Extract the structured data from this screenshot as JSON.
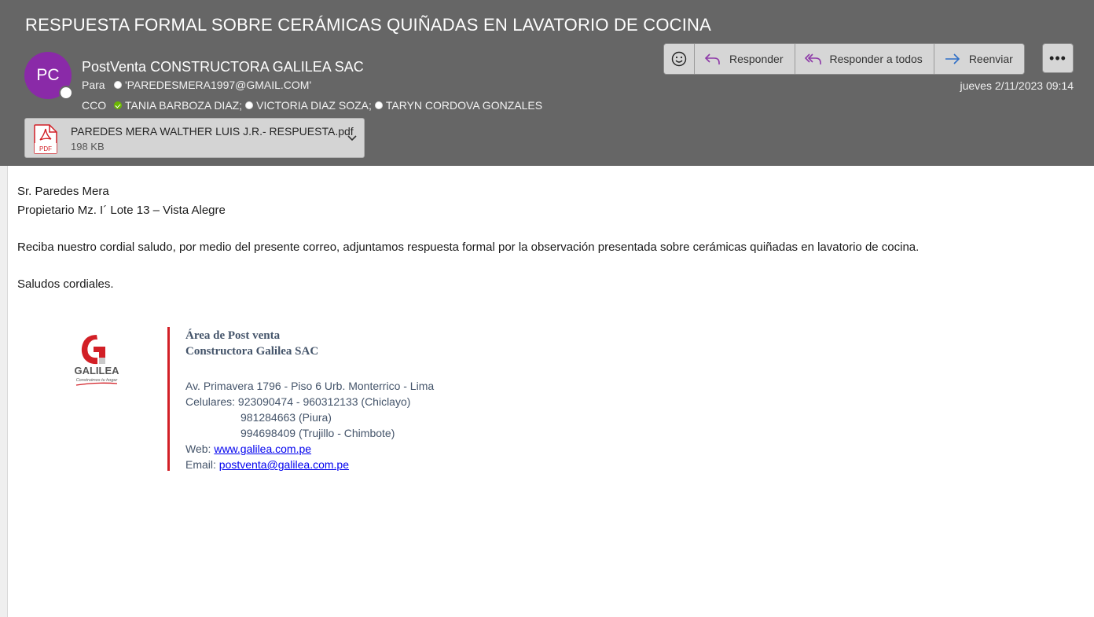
{
  "email": {
    "subject": "RESPUESTA FORMAL SOBRE CERÁMICAS QUIÑADAS EN LAVATORIO DE COCINA",
    "avatar_initials": "PC",
    "sender": "PostVenta CONSTRUCTORA GALILEA SAC",
    "to_label": "Para",
    "to": [
      "'PAREDESMERA1997@GMAIL.COM'"
    ],
    "cc_label": "CCO",
    "cc": [
      "TANIA BARBOZA DIAZ;",
      "VICTORIA DIAZ SOZA;",
      "TARYN CORDOVA GONZALES"
    ],
    "date": "jueves 2/11/2023 09:14"
  },
  "toolbar": {
    "emoji_icon": "smiley-icon",
    "reply_label": "Responder",
    "reply_all_label": "Responder a todos",
    "forward_label": "Reenviar",
    "more_label": "•••"
  },
  "attachment": {
    "name": "PAREDES MERA WALTHER LUIS J.R.- RESPUESTA.pdf",
    "size": "198 KB",
    "icon_text": "PDF"
  },
  "body": {
    "line1": "Sr. Paredes Mera",
    "line2": "Propietario Mz. I´ Lote 13 – Vista Alegre",
    "line3": "Reciba nuestro cordial saludo, por medio del presente correo, adjuntamos respuesta formal por la observación presentada sobre cerámicas quiñadas en lavatorio de cocina.",
    "line4": "Saludos cordiales."
  },
  "signature": {
    "logo_name": "GALILEA",
    "logo_tagline": "Construimos tu hogar",
    "dept": "Área de Post venta",
    "company": "Constructora Galilea SAC",
    "address": "Av. Primavera 1796 - Piso 6 Urb. Monterrico - Lima",
    "phones_label": "Celulares:",
    "phone1": "923090474 - 960312133 (Chiclayo)",
    "phone2": "981284663 (Piura)",
    "phone3": "994698409 (Trujillo - Chimbote)",
    "web_label": "Web:",
    "web": "www.galilea.com.pe",
    "email_label": "Email:",
    "email": "postventa@galilea.com.pe"
  },
  "colors": {
    "header_bg": "#666666",
    "avatar_bg": "#8a2aa8",
    "accent_red": "#d21f26",
    "reply_icon": "#8e3aa8",
    "forward_icon": "#2f6fc7"
  }
}
